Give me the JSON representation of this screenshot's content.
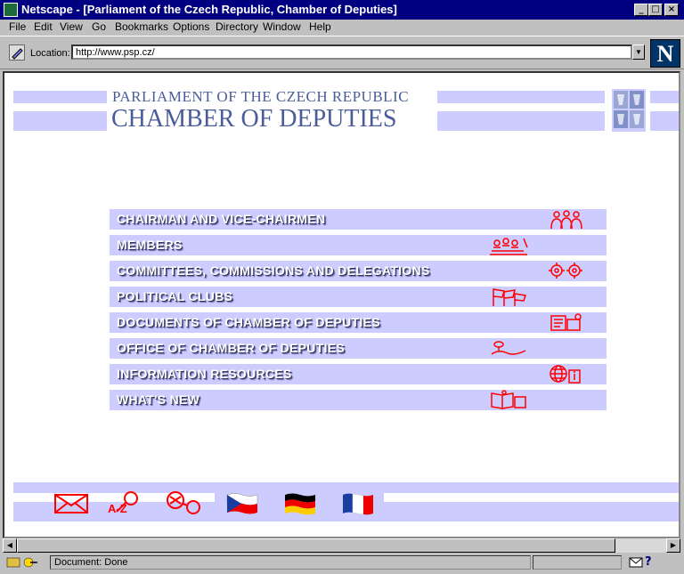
{
  "window": {
    "title": "Netscape - [Parliament of the Czech Republic, Chamber of Deputies]",
    "buttons": [
      "_",
      "□",
      "×"
    ]
  },
  "menubar": [
    "File",
    "Edit",
    "View",
    "Go",
    "Bookmarks",
    "Options",
    "Directory",
    "Window",
    "Help"
  ],
  "toolbar": {
    "location_label": "Location:",
    "location_value": "http://www.psp.cz/",
    "logo_letter": "N"
  },
  "page": {
    "header_line1": "PARLIAMENT OF THE CZECH REPUBLIC",
    "header_line2": "CHAMBER OF DEPUTIES",
    "accent_color": "#ccccff",
    "heading_color": "#4a5d9a",
    "icon_color": "#ff0000",
    "menu_items": [
      {
        "label": "CHAIRMAN AND VICE-CHAIRMEN",
        "icon": "people-group-icon"
      },
      {
        "label": "MEMBERS",
        "icon": "assembly-icon"
      },
      {
        "label": "COMMITTEES, COMMISSIONS AND DELEGATIONS",
        "icon": "gears-icon"
      },
      {
        "label": "POLITICAL CLUBS",
        "icon": "flags-icon"
      },
      {
        "label": "DOCUMENTS OF CHAMBER OF DEPUTIES",
        "icon": "documents-icon"
      },
      {
        "label": "OFFICE OF CHAMBER OF DEPUTIES",
        "icon": "office-icon"
      },
      {
        "label": "INFORMATION RESOURCES",
        "icon": "globe-info-icon"
      },
      {
        "label": "WHAT'S NEW",
        "icon": "news-icon"
      }
    ],
    "footer_icons": [
      "mail-icon",
      "a-z-index-icon",
      "search-icon",
      "czech-flag-icon",
      "german-flag-icon",
      "french-flag-icon"
    ],
    "footer_az_text": "A-Z"
  },
  "status": {
    "text": "Document: Done"
  }
}
